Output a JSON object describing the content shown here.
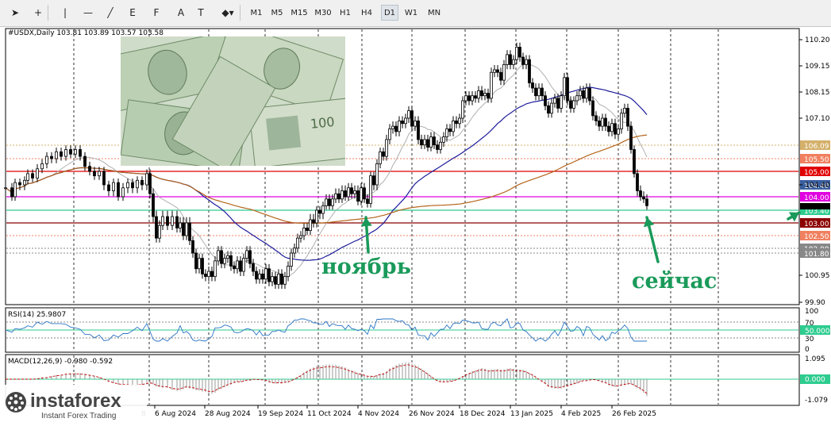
{
  "toolbar": {
    "tools": [
      {
        "name": "cursor-tool-button",
        "icon": "cursor-icon",
        "glyph": "➤"
      },
      {
        "name": "crosshair-tool-button",
        "icon": "crosshair-icon",
        "glyph": "+"
      },
      {
        "name": "vertical-line-button",
        "icon": "vertical-line-icon",
        "glyph": "|"
      },
      {
        "name": "horizontal-line-button",
        "icon": "horizontal-line-icon",
        "glyph": "—"
      },
      {
        "name": "trendline-button",
        "icon": "trendline-icon",
        "glyph": "╱"
      },
      {
        "name": "equidistant-channel-button",
        "icon": "channel-icon",
        "glyph": "E"
      },
      {
        "name": "fibonacci-button",
        "icon": "fibonacci-icon",
        "glyph": "F"
      },
      {
        "name": "text-tool-button",
        "icon": "text-icon",
        "glyph": "A"
      },
      {
        "name": "text-label-button",
        "icon": "text-label-icon",
        "glyph": "T"
      },
      {
        "name": "shapes-menu-button",
        "icon": "shapes-icon",
        "glyph": "◆▾"
      }
    ],
    "timeframes": [
      "M1",
      "M5",
      "M15",
      "M30",
      "H1",
      "H4",
      "D1",
      "W1",
      "MN"
    ],
    "active_timeframe": "D1"
  },
  "header": {
    "symbol_line": "#USDX,Daily  103.81 103.89 103.57 103.58"
  },
  "annotations": {
    "november": "ноябрь",
    "now": "сейчас",
    "arrow_color": "#1a9a5a"
  },
  "logo": {
    "name": "instaforex",
    "tagline": "Instant Forex Trading"
  },
  "chart_data": [
    {
      "type": "candlestick",
      "title": "#USDX,Daily",
      "ohlc_last": {
        "open": 103.81,
        "high": 103.89,
        "low": 103.57,
        "close": 103.58
      },
      "ylim": [
        99.9,
        110.7
      ],
      "y_ticks": [
        "110.20",
        "109.15",
        "108.15",
        "107.10",
        "104.40",
        "100.95",
        "99.90"
      ],
      "price_levels": [
        {
          "label": "106.09",
          "value": 106.09,
          "color": "#d4b06a",
          "style": "dotted"
        },
        {
          "label": "105.50",
          "value": 105.5,
          "color": "#f08060",
          "style": "dotted"
        },
        {
          "label": "105.00",
          "value": 105.0,
          "color": "#e00000",
          "style": "solid"
        },
        {
          "label": "104.40",
          "value": 104.4,
          "color": "#3a5fa0",
          "style": "none"
        },
        {
          "label": "104.00",
          "value": 104.0,
          "color": "#e000e0",
          "style": "solid"
        },
        {
          "label": "103.40",
          "value": 103.4,
          "color": "#2ecc8f",
          "style": "solid"
        },
        {
          "label": "103.00",
          "value": 103.0,
          "color": "#8b0000",
          "style": "solid"
        },
        {
          "label": "102.50",
          "value": 102.5,
          "color": "#f08060",
          "style": "dotted"
        },
        {
          "label": "102.00",
          "value": 102.0,
          "color": "#888888",
          "style": "dotted"
        },
        {
          "label": "101.80",
          "value": 101.8,
          "color": "#888888",
          "style": "dotted"
        }
      ],
      "x_labels": [
        "6 Aug 2024",
        "28 Aug 2024",
        "19 Sep 2024",
        "11 Oct 2024",
        "4 Nov 2024",
        "26 Nov 2024",
        "18 Dec 2024",
        "13 Jan 2025",
        "4 Feb 2025",
        "26 Feb 2025"
      ],
      "x_partial_label": "8",
      "close_path": [
        [
          0,
          104.3
        ],
        [
          8,
          104.0
        ],
        [
          12,
          104.5
        ],
        [
          18,
          104.4
        ],
        [
          24,
          104.6
        ],
        [
          28,
          104.9
        ],
        [
          34,
          104.7
        ],
        [
          40,
          105.1
        ],
        [
          46,
          105.3
        ],
        [
          52,
          105.6
        ],
        [
          58,
          105.5
        ],
        [
          64,
          105.8
        ],
        [
          70,
          105.6
        ],
        [
          76,
          105.9
        ],
        [
          82,
          105.7
        ],
        [
          88,
          105.9
        ],
        [
          94,
          105.6
        ],
        [
          100,
          105.2
        ],
        [
          106,
          105.0
        ],
        [
          112,
          104.8
        ],
        [
          118,
          105.0
        ],
        [
          124,
          104.4
        ],
        [
          130,
          104.2
        ],
        [
          136,
          104.5
        ],
        [
          142,
          104.0
        ],
        [
          148,
          104.3
        ],
        [
          154,
          104.5
        ],
        [
          160,
          104.3
        ],
        [
          166,
          104.6
        ],
        [
          172,
          104.4
        ],
        [
          178,
          104.9
        ],
        [
          182,
          104.1
        ],
        [
          186,
          103.2
        ],
        [
          190,
          102.4
        ],
        [
          194,
          102.9
        ],
        [
          198,
          103.2
        ],
        [
          204,
          102.9
        ],
        [
          210,
          103.2
        ],
        [
          216,
          102.8
        ],
        [
          220,
          103.0
        ],
        [
          224,
          102.5
        ],
        [
          228,
          103.0
        ],
        [
          232,
          102.3
        ],
        [
          236,
          101.8
        ],
        [
          240,
          101.2
        ],
        [
          244,
          101.6
        ],
        [
          248,
          101.0
        ],
        [
          252,
          100.9
        ],
        [
          256,
          101.1
        ],
        [
          260,
          100.9
        ],
        [
          264,
          101.5
        ],
        [
          268,
          101.9
        ],
        [
          272,
          101.4
        ],
        [
          276,
          101.6
        ],
        [
          280,
          101.7
        ],
        [
          284,
          101.3
        ],
        [
          288,
          101.2
        ],
        [
          292,
          101.5
        ],
        [
          296,
          101.1
        ],
        [
          300,
          101.6
        ],
        [
          304,
          101.9
        ],
        [
          308,
          101.4
        ],
        [
          312,
          101.1
        ],
        [
          316,
          100.8
        ],
        [
          320,
          101.0
        ],
        [
          324,
          100.8
        ],
        [
          328,
          101.2
        ],
        [
          332,
          100.7
        ],
        [
          336,
          100.9
        ],
        [
          340,
          100.6
        ],
        [
          344,
          101.0
        ],
        [
          348,
          100.6
        ],
        [
          352,
          100.9
        ],
        [
          356,
          101.3
        ],
        [
          360,
          101.8
        ],
        [
          364,
          102.0
        ],
        [
          368,
          102.4
        ],
        [
          372,
          102.5
        ],
        [
          376,
          102.8
        ],
        [
          380,
          102.7
        ],
        [
          384,
          103.1
        ],
        [
          388,
          103.0
        ],
        [
          392,
          103.4
        ],
        [
          396,
          103.3
        ],
        [
          400,
          103.6
        ],
        [
          404,
          103.9
        ],
        [
          408,
          103.6
        ],
        [
          412,
          103.9
        ],
        [
          416,
          104.1
        ],
        [
          420,
          103.9
        ],
        [
          424,
          104.2
        ],
        [
          428,
          104.0
        ],
        [
          432,
          104.3
        ],
        [
          436,
          104.1
        ],
        [
          440,
          104.2
        ],
        [
          444,
          103.8
        ],
        [
          448,
          104.3
        ],
        [
          452,
          103.9
        ],
        [
          456,
          103.7
        ],
        [
          460,
          104.8
        ],
        [
          464,
          104.4
        ],
        [
          468,
          105.3
        ],
        [
          472,
          105.8
        ],
        [
          476,
          105.6
        ],
        [
          480,
          106.3
        ],
        [
          484,
          106.7
        ],
        [
          488,
          106.8
        ],
        [
          492,
          106.6
        ],
        [
          496,
          107.0
        ],
        [
          500,
          106.9
        ],
        [
          504,
          107.1
        ],
        [
          508,
          107.4
        ],
        [
          512,
          106.8
        ],
        [
          516,
          107.0
        ],
        [
          520,
          106.3
        ],
        [
          524,
          106.1
        ],
        [
          528,
          106.3
        ],
        [
          532,
          106.0
        ],
        [
          536,
          106.4
        ],
        [
          540,
          106.1
        ],
        [
          544,
          105.9
        ],
        [
          548,
          106.2
        ],
        [
          552,
          106.4
        ],
        [
          556,
          106.7
        ],
        [
          560,
          106.6
        ],
        [
          564,
          107.0
        ],
        [
          568,
          106.9
        ],
        [
          572,
          107.1
        ],
        [
          576,
          107.8
        ],
        [
          580,
          108.0
        ],
        [
          584,
          107.8
        ],
        [
          588,
          108.0
        ],
        [
          592,
          107.9
        ],
        [
          596,
          108.2
        ],
        [
          600,
          108.0
        ],
        [
          604,
          108.1
        ],
        [
          608,
          107.9
        ],
        [
          612,
          108.9
        ],
        [
          616,
          109.0
        ],
        [
          620,
          108.9
        ],
        [
          624,
          108.6
        ],
        [
          628,
          109.2
        ],
        [
          632,
          109.6
        ],
        [
          636,
          109.2
        ],
        [
          640,
          109.4
        ],
        [
          644,
          109.9
        ],
        [
          648,
          109.5
        ],
        [
          652,
          109.2
        ],
        [
          656,
          109.4
        ],
        [
          660,
          108.5
        ],
        [
          664,
          108.3
        ],
        [
          668,
          108.0
        ],
        [
          672,
          108.3
        ],
        [
          676,
          108.0
        ],
        [
          680,
          107.6
        ],
        [
          684,
          107.3
        ],
        [
          688,
          107.7
        ],
        [
          692,
          107.9
        ],
        [
          696,
          107.5
        ],
        [
          700,
          108.0
        ],
        [
          704,
          108.7
        ],
        [
          708,
          107.8
        ],
        [
          712,
          107.5
        ],
        [
          716,
          107.8
        ],
        [
          720,
          108.0
        ],
        [
          724,
          108.2
        ],
        [
          728,
          107.9
        ],
        [
          732,
          108.3
        ],
        [
          736,
          107.8
        ],
        [
          740,
          107.2
        ],
        [
          744,
          107.0
        ],
        [
          748,
          106.8
        ],
        [
          752,
          107.1
        ],
        [
          756,
          106.8
        ],
        [
          760,
          106.6
        ],
        [
          764,
          106.9
        ],
        [
          768,
          106.5
        ],
        [
          772,
          106.7
        ],
        [
          776,
          107.3
        ],
        [
          780,
          107.5
        ],
        [
          784,
          106.8
        ],
        [
          788,
          105.9
        ],
        [
          792,
          104.9
        ],
        [
          796,
          104.2
        ],
        [
          800,
          104.0
        ],
        [
          804,
          103.9
        ],
        [
          808,
          103.6
        ]
      ]
    },
    {
      "type": "line",
      "title": "RSI(14) 25.9807",
      "ylim": [
        0,
        100
      ],
      "y_ticks": [
        "100",
        "70",
        "50.0000",
        "30",
        "0"
      ]
    },
    {
      "type": "histogram",
      "title": "MACD(12,26,9) -0.980 -0.592",
      "ylim": [
        -1.079,
        1.095
      ],
      "y_ticks": [
        "1.095",
        "0.000",
        "-1.079"
      ]
    }
  ]
}
